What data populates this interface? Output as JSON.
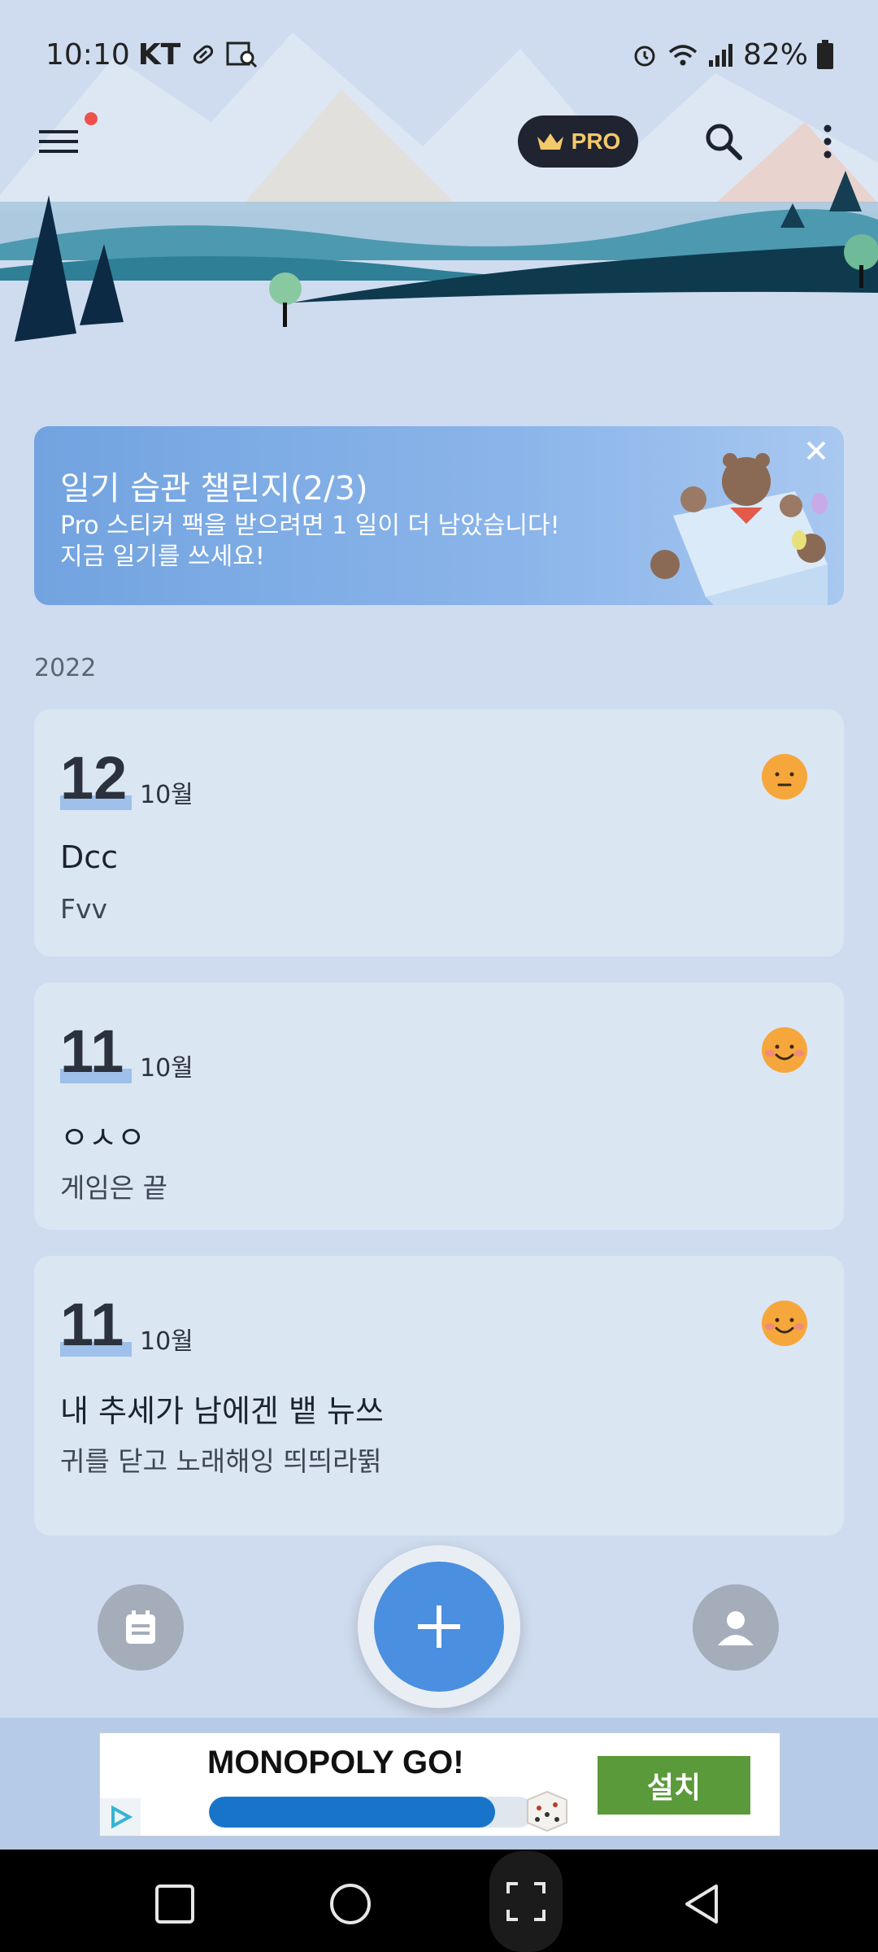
{
  "status_bar": {
    "time": "10:10",
    "carrier": "KT",
    "battery": "82%"
  },
  "top_bar": {
    "pro_label": "PRO",
    "has_notification": true
  },
  "challenge": {
    "title": "일기 습관 챌린지(2/3)",
    "message": "Pro 스티커 팩을 받으려면 1 일이 더 남았습니다!\n지금 일기를 쓰세요!"
  },
  "year": "2022",
  "entries": [
    {
      "day": "12",
      "month": "10월",
      "title": "Dcc",
      "body": "Fvv",
      "mood": "neutral-face-icon"
    },
    {
      "day": "11",
      "month": "10월",
      "title": "ㅇㅅㅇ",
      "body": "게임은 끝",
      "mood": "smiling-face-icon"
    },
    {
      "day": "11",
      "month": "10월",
      "title": "내 추세가 남에겐 뱉 뉴쓰",
      "body": "귀를 닫고 노래해잉 띄띄라뛹",
      "mood": "smiling-face-icon"
    }
  ],
  "ad": {
    "title": "MONOPOLY GO!",
    "install_label": "설치",
    "progress": 0.88
  },
  "colors": {
    "accent": "#4a8fe0",
    "pro_gold": "#f4c96a",
    "install_green": "#5a9a3a",
    "mood_orange": "#f6a73c"
  }
}
